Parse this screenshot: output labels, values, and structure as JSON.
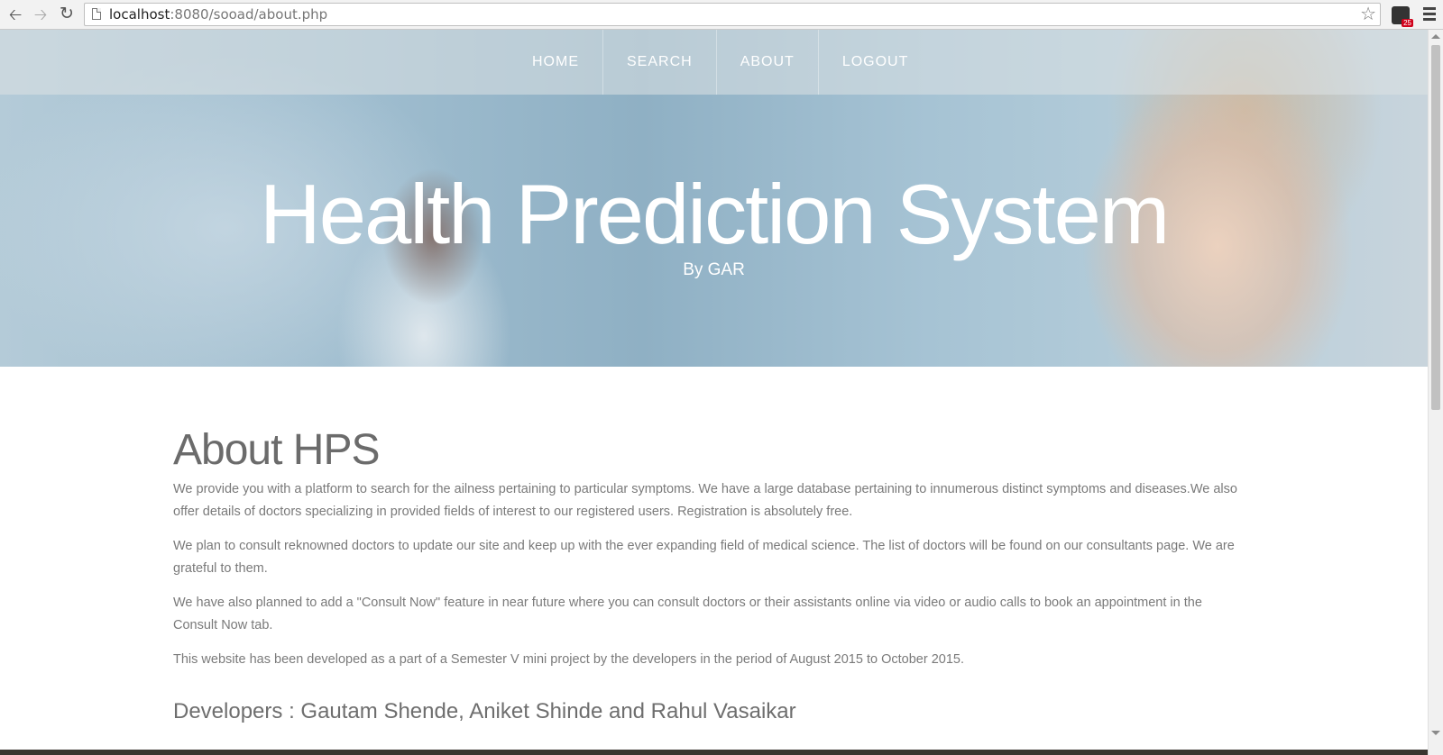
{
  "browser": {
    "url_host": "localhost",
    "url_rest": ":8080/sooad/about.php",
    "ext_badge": "25"
  },
  "nav": {
    "items": [
      {
        "label": "HOME"
      },
      {
        "label": "SEARCH"
      },
      {
        "label": "ABOUT"
      },
      {
        "label": "LOGOUT"
      }
    ]
  },
  "hero": {
    "title": "Health Prediction System",
    "subtitle": "By GAR"
  },
  "about": {
    "heading": "About HPS",
    "paragraphs": [
      "We provide you with a platform to search for the ailness pertaining to particular symptoms. We have a large database pertaining to innumerous distinct symptoms and diseases.We also offer details of doctors specializing in provided fields of interest to our registered users. Registration is absolutely free.",
      "We plan to consult reknowned doctors to update our site and keep up with the ever expanding field of medical science. The list of doctors will be found on our consultants page. We are grateful to them.",
      "We have also planned to add a \"Consult Now\" feature in near future where you can consult doctors or their assistants online via video or audio calls to book an appointment in the Consult Now tab.",
      "This website has been developed as a part of a Semester V mini project by the developers in the period of August 2015 to October 2015."
    ],
    "developers": "Developers : Gautam Shende, Aniket Shinde and Rahul Vasaikar"
  },
  "icons": {
    "back": "back-arrow-icon",
    "forward": "forward-arrow-icon",
    "reload": "reload-icon",
    "page": "page-icon",
    "star": "star-icon",
    "extension": "extension-icon",
    "menu": "menu-icon"
  }
}
